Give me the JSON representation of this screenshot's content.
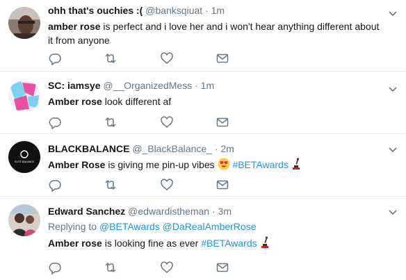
{
  "tweets": [
    {
      "name": "ohh that's ouchies :(",
      "handle": "@banksqiuat",
      "dot": "·",
      "time": "1m",
      "bold": "amber rose",
      "text": " is perfect and i love her and i won't hear anything different about it from anyone"
    },
    {
      "name": "SC: iamsye",
      "handle": "@__OrganizedMess",
      "dot": "·",
      "time": "1m",
      "bold": "Amber rose",
      "text": " look different af"
    },
    {
      "name": "BLACKBALANCE",
      "handle": "@_BlackBalance_",
      "dot": "·",
      "time": "2m",
      "bold": "Amber Rose",
      "text": " is giving me pin-up vibes ",
      "hashtag": "#BETAwards",
      "avatar_text": "ELITE BALANCE"
    },
    {
      "name": "Edward Sanchez",
      "handle": "@edwardistheman",
      "dot": "·",
      "time": "3m",
      "reply_prefix": "Replying to",
      "reply_mention_1": "@BETAwards",
      "reply_mention_2": "@DaRealAmberRose",
      "bold": "Amber rose",
      "text": " is looking fine as ever ",
      "hashtag": "#BETAwards"
    }
  ],
  "icons": [
    "reply-icon",
    "retweet-icon",
    "like-icon",
    "dm-icon",
    "chevron-down-icon"
  ],
  "colors": {
    "link": "#1b95e0",
    "muted": "#657786",
    "text": "#14171a",
    "divider": "#e6ecf0"
  }
}
